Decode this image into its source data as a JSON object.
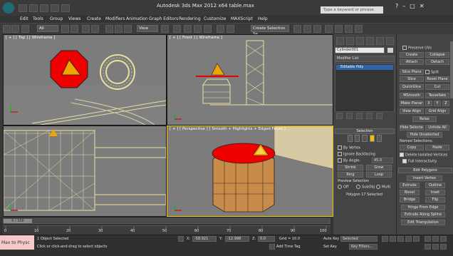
{
  "title_bar": {
    "title": "Autodesk 3ds Max  2012 x64        table.max",
    "search_placeholder": "Type a keyword or phrase"
  },
  "menu": [
    "Edit",
    "Tools",
    "Group",
    "Views",
    "Create",
    "Modifiers",
    "Animation",
    "Graph Editors",
    "Rendering",
    "Customize",
    "MAXScript",
    "Help"
  ],
  "toolbar": {
    "selection_filter": "All",
    "reference_coord": "View",
    "named_selection": "Create Selection Se"
  },
  "viewports": {
    "top": "[ + ] [ Top ] [ Wireframe ]",
    "front": "[ + ] [ Front ] [ Wireframe ]",
    "perspective": "[ + ] [ Perspective ] [ Smooth + Highlights + Edged Faces ]"
  },
  "command_panel": {
    "object_name": "Cylinder001",
    "modifier_list": "Modifier List",
    "stack_item": "Editable Poly",
    "selection_title": "Selection",
    "by_vertex": "By Vertex",
    "ignore_backfacing": "Ignore Backfacing",
    "by_angle": "By Angle:",
    "angle_value": "45.0",
    "shrink": "Shrink",
    "grow": "Grow",
    "ring": "Ring",
    "loop": "Loop",
    "preview_selection": "Preview Selection",
    "preview_off": "Off",
    "preview_subobj": "SubObj",
    "preview_multi": "Multi",
    "status": "Polygon 17 Selected"
  },
  "edit_geometry": {
    "preserve_uvs": "Preserve UVs",
    "create": "Create",
    "collapse": "Collapse",
    "attach": "Attach",
    "detach": "Detach",
    "slice_plane": "Slice Plane",
    "split": "Split",
    "slice": "Slice",
    "reset_plane": "Reset Plane",
    "quickslice": "QuickSlice",
    "cut": "Cut",
    "msmooth": "MSmooth",
    "tessellate": "Tessellate",
    "make_planar": "Make Planar",
    "x": "X",
    "y": "Y",
    "z": "Z",
    "view_align": "View Align",
    "grid_align": "Grid Align",
    "relax": "Relax",
    "hide_selected": "Hide Selected",
    "unhide_all": "Unhide All",
    "hide_unselected": "Hide Unselected",
    "named_selections": "Named Selections:",
    "copy": "Copy",
    "paste": "Paste",
    "delete_isolated": "Delete Isolated Vertices",
    "full_interactivity": "Full Interactivity"
  },
  "edit_polygons": {
    "title": "Edit Polygons",
    "insert_vertex": "Insert Vertex",
    "extrude": "Extrude",
    "outline": "Outline",
    "bevel": "Bevel",
    "inset": "Inset",
    "bridge": "Bridge",
    "flip": "Flip",
    "hinge": "Hinge From Edge",
    "extrude_spline": "Extrude Along Spline",
    "edit_triangulation": "Edit Triangulation"
  },
  "timeline": {
    "frame": "0 / 100",
    "ticks": [
      "0",
      "10",
      "20",
      "30",
      "40",
      "50",
      "60",
      "70",
      "80",
      "90",
      "100"
    ]
  },
  "status": {
    "maxscript": "Max to Physc",
    "selected": "1 Object Selected",
    "prompt": "Click or click-and-drag to select objects",
    "x_label": "X:",
    "x_value": "-58.921",
    "y_label": "Y:",
    "y_value": "-12.998",
    "z_label": "Z:",
    "z_value": "0.0",
    "grid": "Grid = 10.0",
    "add_time_tag": "Add Time Tag",
    "auto_key": "Auto Key",
    "set_key": "Set Key",
    "selected_dropdown": "Selected",
    "key_filters": "Key Filters..."
  },
  "colors": {
    "viewport_bg": "#7c7c7c",
    "active_border": "#f3c000",
    "selection_red": "#e00000",
    "wire_yellow": "#e8e0a0"
  }
}
